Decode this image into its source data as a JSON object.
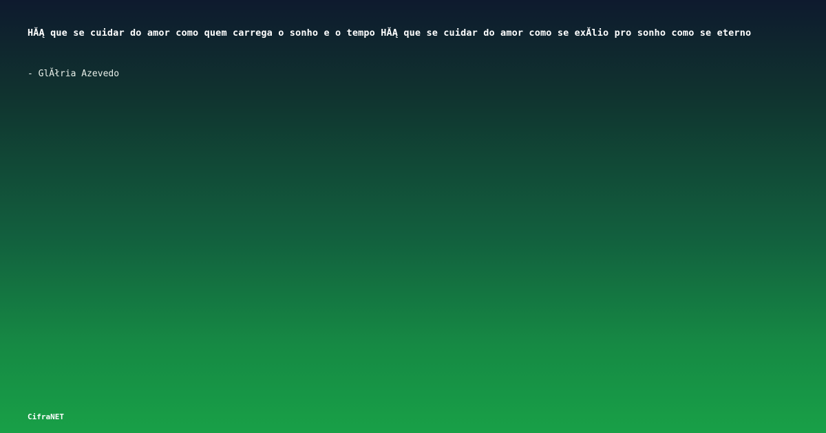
{
  "quote": {
    "text": "HĂĄ que se cuidar do amor como quem carrega o sonho e o tempo HĂĄ que se cuidar do amor como se exĂ­lio pro sonho como se eterno"
  },
  "author": {
    "text": "- GlĂłria Azevedo"
  },
  "brand": {
    "name": "CifraNET"
  },
  "colors": {
    "background_top": "#0e1a2e",
    "background_bottom": "#18a047",
    "text": "#ffffff"
  }
}
